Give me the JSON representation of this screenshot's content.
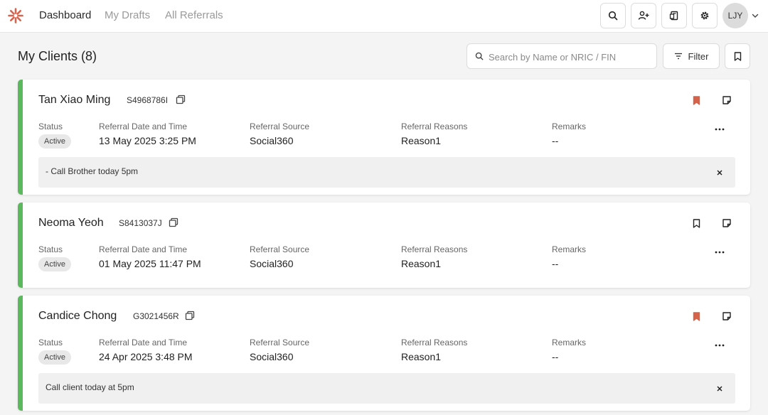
{
  "nav": {
    "links": [
      "Dashboard",
      "My Drafts",
      "All Referrals"
    ],
    "user_initials": "LJY"
  },
  "icons": {
    "logo": "asterisk-logo-icon",
    "search": "search-icon",
    "add_user": "add-user-icon",
    "document": "document-icon",
    "settings": "gear-icon",
    "chevron": "chevron-down-icon",
    "copy": "copy-icon",
    "bookmark": "bookmark-icon",
    "note": "note-icon",
    "more": "more-horizontal-icon",
    "close": "close-icon",
    "filter": "filter-icon"
  },
  "colors": {
    "accent_status": "#5cb85c",
    "bookmark_active": "#d4634a",
    "logo": "#d9634c"
  },
  "page": {
    "title": "My Clients (8)",
    "search_placeholder": "Search by Name or NRIC / FIN",
    "filter_label": "Filter"
  },
  "field_labels": {
    "status": "Status",
    "referral_date": "Referral Date and Time",
    "referral_source": "Referral Source",
    "referral_reasons": "Referral Reasons",
    "remarks": "Remarks"
  },
  "clients": [
    {
      "name": "Tan Xiao Ming",
      "id": "S4968786I",
      "status": "Active",
      "referral_date": "13 May 2025 3:25 PM",
      "referral_source": "Social360",
      "referral_reasons": "Reason1",
      "remarks": "--",
      "bookmarked": true,
      "note": "- Call Brother today 5pm"
    },
    {
      "name": "Neoma Yeoh",
      "id": "S8413037J",
      "status": "Active",
      "referral_date": "01 May 2025 11:47 PM",
      "referral_source": "Social360",
      "referral_reasons": "Reason1",
      "remarks": "--",
      "bookmarked": false,
      "note": ""
    },
    {
      "name": "Candice Chong",
      "id": "G3021456R",
      "status": "Active",
      "referral_date": "24 Apr 2025 3:48 PM",
      "referral_source": "Social360",
      "referral_reasons": "Reason1",
      "remarks": "--",
      "bookmarked": true,
      "note": "Call client today at 5pm"
    }
  ]
}
